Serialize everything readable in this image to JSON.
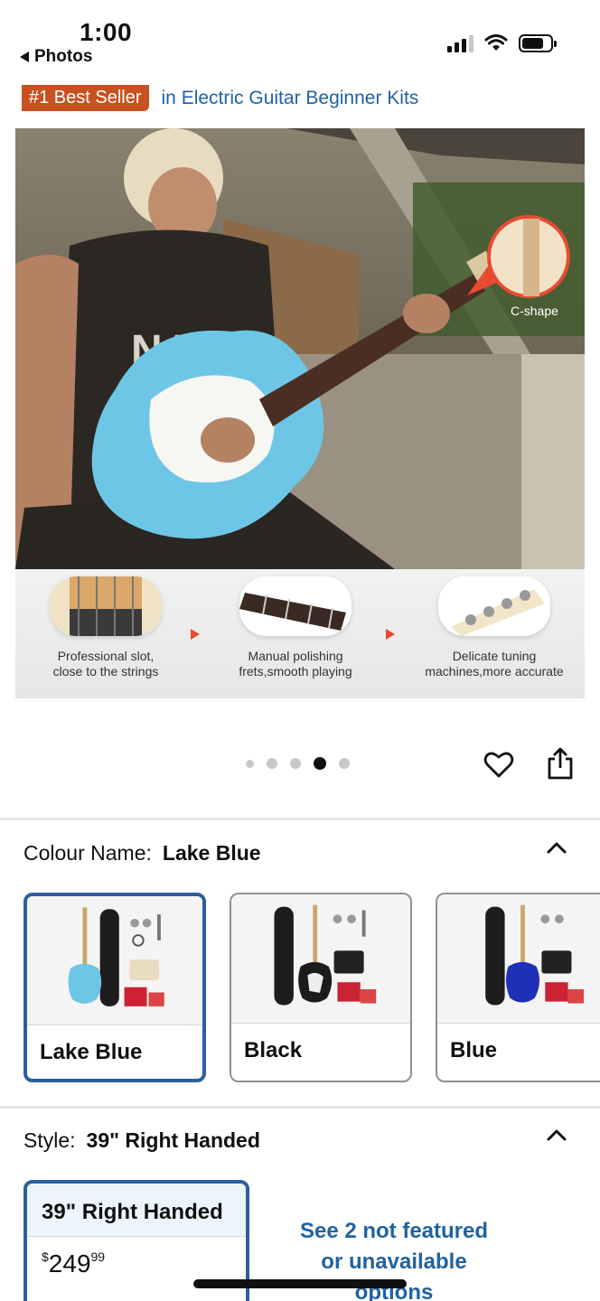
{
  "status_bar": {
    "time": "1:00",
    "back_app": "Photos",
    "icons": [
      "signal-icon",
      "wifi-icon",
      "battery-icon"
    ]
  },
  "best_seller": {
    "badge": "#1 Best Seller",
    "category": "in Electric Guitar Beginner Kits",
    "badge_color": "#c7511f",
    "link_color": "#2162a1"
  },
  "hero": {
    "callout": "C-shape",
    "features": [
      {
        "caption_line1": "Professional slot,",
        "caption_line2": "close to the strings"
      },
      {
        "caption_line1": "Manual polishing",
        "caption_line2": "frets,smooth playing"
      },
      {
        "caption_line1": "Delicate tuning",
        "caption_line2": "machines,more accurate"
      }
    ],
    "carousel": {
      "total": 5,
      "active_index": 4
    }
  },
  "actions": {
    "icons": [
      "heart-icon",
      "share-icon"
    ]
  },
  "colour": {
    "label": "Colour Name:",
    "selected": "Lake Blue",
    "options": [
      {
        "name": "Lake Blue",
        "guitar_color": "#6ec6e6",
        "selected": true
      },
      {
        "name": "Black",
        "guitar_color": "#1c1c1c",
        "selected": false
      },
      {
        "name": "Blue",
        "guitar_color": "#1f2fb8",
        "selected": false
      }
    ]
  },
  "style": {
    "label": "Style:",
    "selected": "39\" Right Handed",
    "options": [
      {
        "name": "39\" Right Handed",
        "price_symbol": "$",
        "price_whole": "249",
        "price_fraction": "99",
        "selected": true
      }
    ],
    "not_featured_line1": "See 2 not featured",
    "not_featured_line2": "or unavailable",
    "not_featured_line3": "options"
  },
  "accent_color": "#2b5f9e"
}
